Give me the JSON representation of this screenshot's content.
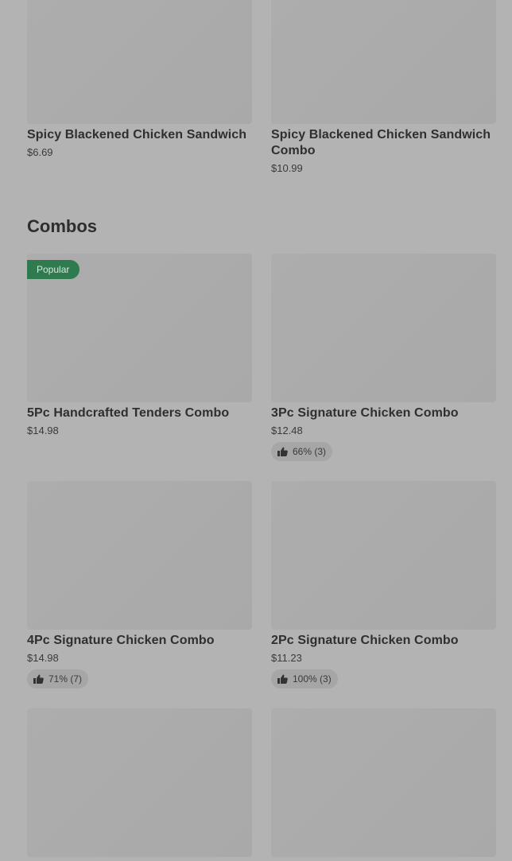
{
  "top_items": [
    {
      "name": "Spicy Blackened Chicken Sandwich",
      "price": "$6.69"
    },
    {
      "name": "Spicy Blackened Chicken Sandwich Combo",
      "price": "$10.99"
    }
  ],
  "combos": {
    "title": "Combos",
    "items": [
      {
        "name": "5Pc Handcrafted Tenders Combo",
        "price": "$14.98",
        "badge": "Popular"
      },
      {
        "name": "3Pc Signature Chicken Combo",
        "price": "$12.48",
        "rating": "66% (3)"
      },
      {
        "name": "4Pc Signature Chicken Combo",
        "price": "$14.98",
        "rating": "71% (7)"
      },
      {
        "name": "2Pc Signature Chicken Combo",
        "price": "$11.23",
        "rating": "100% (3)"
      }
    ]
  },
  "icons": {
    "rating": "thumbs-up-icon"
  },
  "colors": {
    "badge": "#2f7a4f",
    "overlay": "#b3b3b3"
  }
}
